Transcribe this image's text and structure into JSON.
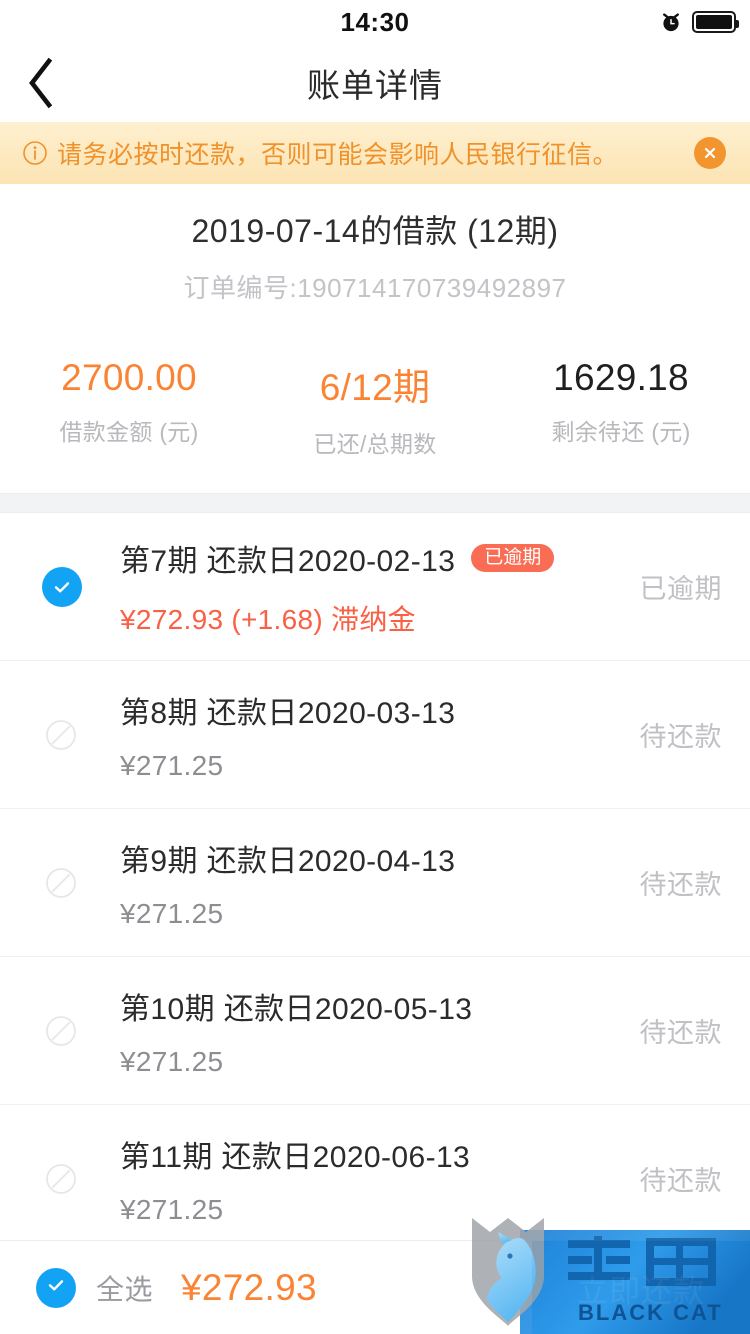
{
  "status_bar": {
    "time": "14:30",
    "alarm_icon": "alarm-clock-icon",
    "battery_icon": "battery-full-icon"
  },
  "nav": {
    "back_icon": "chevron-left-icon",
    "title": "账单详情"
  },
  "notice": {
    "info_icon": "info-circle-icon",
    "message": "请务必按时还款，否则可能会影响人民银行征信。",
    "close_icon": "close-circle-icon",
    "text_color": "#F0922B",
    "bg_color": "#FDE9C0"
  },
  "summary": {
    "loan_title": "2019-07-14的借款 (12期)",
    "order_label_and_no": "订单编号:190714170739492897",
    "stats": [
      {
        "value": "2700.00",
        "label": "借款金额 (元)",
        "accent": true
      },
      {
        "value": "6/12期",
        "label": "已还/总期数",
        "accent": true
      },
      {
        "value": "1629.18",
        "label": "剩余待还 (元)",
        "accent": false
      }
    ],
    "accent_color": "#FA8334"
  },
  "installments": [
    {
      "checkbox": "checked",
      "period": "第7期 还款日2020-02-13",
      "badge": "已逾期",
      "amount": "¥272.93 (+1.68) 滞纳金",
      "amount_state": "overdue",
      "status": "已逾期"
    },
    {
      "checkbox": "disabled",
      "period": "第8期 还款日2020-03-13",
      "badge": "",
      "amount": "¥271.25",
      "amount_state": "normal",
      "status": "待还款"
    },
    {
      "checkbox": "disabled",
      "period": "第9期 还款日2020-04-13",
      "badge": "",
      "amount": "¥271.25",
      "amount_state": "normal",
      "status": "待还款"
    },
    {
      "checkbox": "disabled",
      "period": "第10期 还款日2020-05-13",
      "badge": "",
      "amount": "¥271.25",
      "amount_state": "normal",
      "status": "待还款"
    },
    {
      "checkbox": "disabled",
      "period": "第11期 还款日2020-06-13",
      "badge": "",
      "amount": "¥271.25",
      "amount_state": "normal",
      "status": "待还款"
    }
  ],
  "bottom_bar": {
    "select_all_label": "全选",
    "select_all_checked": true,
    "total": "¥272.93",
    "pay_button": "立即还款",
    "pay_button_color": "#3EA7F5"
  },
  "watermark": {
    "brand_cn": "黑猫",
    "brand_en": "BLACK CAT"
  }
}
